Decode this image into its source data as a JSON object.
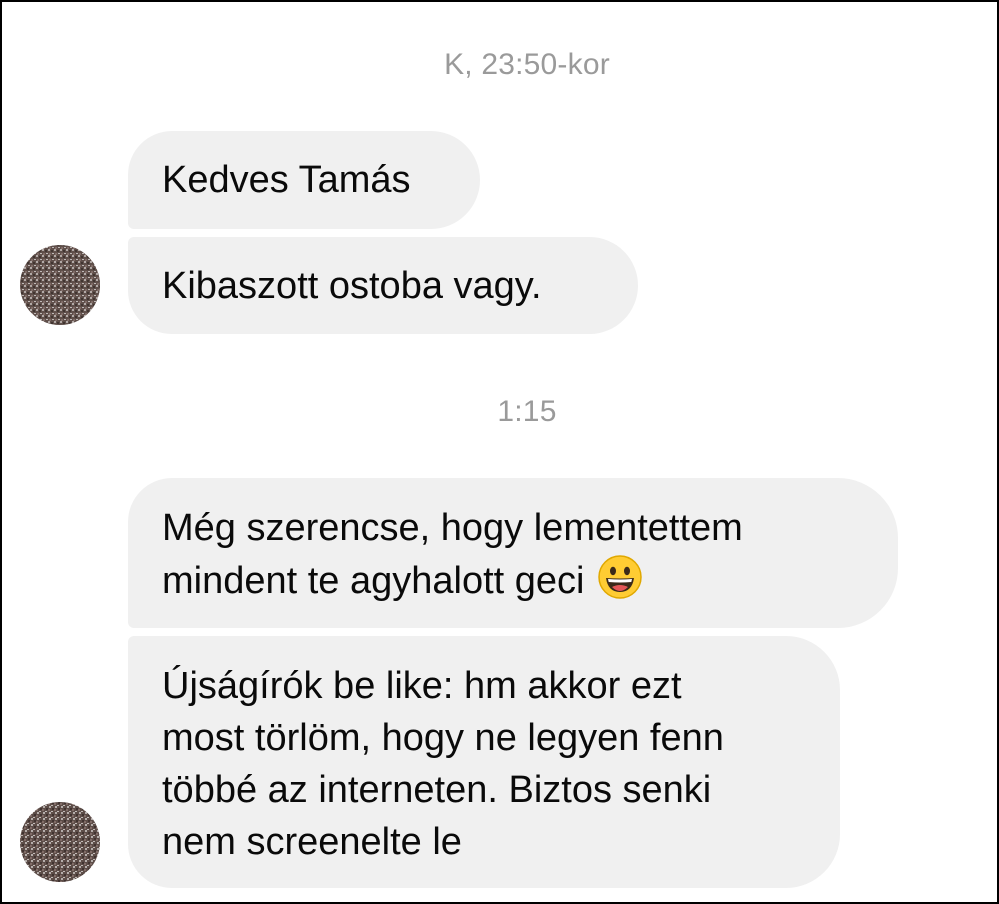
{
  "conversation": {
    "timestamps": [
      "K, 23:50-kor",
      "1:15"
    ],
    "messages": [
      {
        "lines": [
          "Kedves Tamás"
        ]
      },
      {
        "lines": [
          "Kibaszott ostoba vagy."
        ]
      },
      {
        "lines": [
          "Még szerencse, hogy lementettem",
          "mindent te agyhalott geci"
        ],
        "emoji": "grinning-face-emoji"
      },
      {
        "lines": [
          "Újságírók be like: hm akkor ezt",
          "most törlöm, hogy ne legyen fenn",
          "többé az interneten. Biztos senki",
          "nem screenelte le"
        ]
      }
    ]
  },
  "colors": {
    "bubble_bg": "#f0f0f0",
    "timestamp_text": "#9a9a9a",
    "message_text": "#0a0a0a",
    "frame_border": "#000000"
  }
}
